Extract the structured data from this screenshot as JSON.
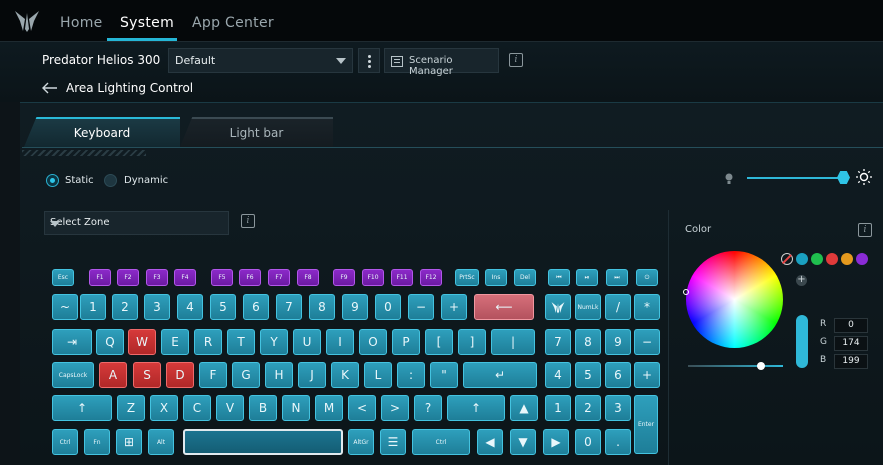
{
  "nav": {
    "tabs": [
      "Home",
      "System",
      "App Center"
    ]
  },
  "header": {
    "device": "Predator Helios 300",
    "profile": "Default",
    "scenario_label": "Scenario Manager",
    "page_title": "Area Lighting Control"
  },
  "tabs": {
    "keyboard": "Keyboard",
    "lightbar": "Light bar"
  },
  "mode": {
    "static": "Static",
    "dynamic": "Dynamic",
    "selected": "Static"
  },
  "brightness": 1.0,
  "zone": {
    "placeholder": "Select Zone"
  },
  "color": {
    "label": "Color",
    "swatches": [
      "#1aa0c0",
      "#1fbf4e",
      "#e03a3a",
      "#e59a1e",
      "#8a2bd6"
    ],
    "r_label": "R",
    "g_label": "G",
    "b_label": "B",
    "r": "0",
    "g": "174",
    "b": "199",
    "add": "+"
  },
  "keyboard": {
    "row0": [
      "Esc",
      "F1",
      "F2",
      "F3",
      "F4",
      "F5",
      "F6",
      "F7",
      "F8",
      "F9",
      "F10",
      "F11",
      "F12",
      "PrtSc",
      "Ins",
      "Del",
      "⏮",
      "⏯",
      "⏭",
      "⏻"
    ],
    "row1": [
      "~",
      "1",
      "2",
      "3",
      "4",
      "5",
      "6",
      "7",
      "8",
      "9",
      "0",
      "−",
      "+",
      "⟵",
      "",
      "NumLk",
      "/",
      "*"
    ],
    "row2": [
      "⇥",
      "Q",
      "W",
      "E",
      "R",
      "T",
      "Y",
      "U",
      "I",
      "O",
      "P",
      "[",
      "]",
      "|",
      "7",
      "8",
      "9",
      "−"
    ],
    "row3": [
      "CapsLock",
      "A",
      "S",
      "D",
      "F",
      "G",
      "H",
      "J",
      "K",
      "L",
      ":",
      "\"",
      "↵",
      "4",
      "5",
      "6",
      "+"
    ],
    "row4": [
      "↑",
      "Z",
      "X",
      "C",
      "V",
      "B",
      "N",
      "M",
      "<",
      ">",
      "?",
      "↑",
      "▲",
      "1",
      "2",
      "3",
      "Enter"
    ],
    "row5": [
      "Ctrl",
      "Fn",
      "⊞",
      "Alt",
      "",
      "AltGr",
      "☰",
      "Ctrl",
      "◀",
      "▼",
      "▶",
      "0",
      "."
    ]
  }
}
